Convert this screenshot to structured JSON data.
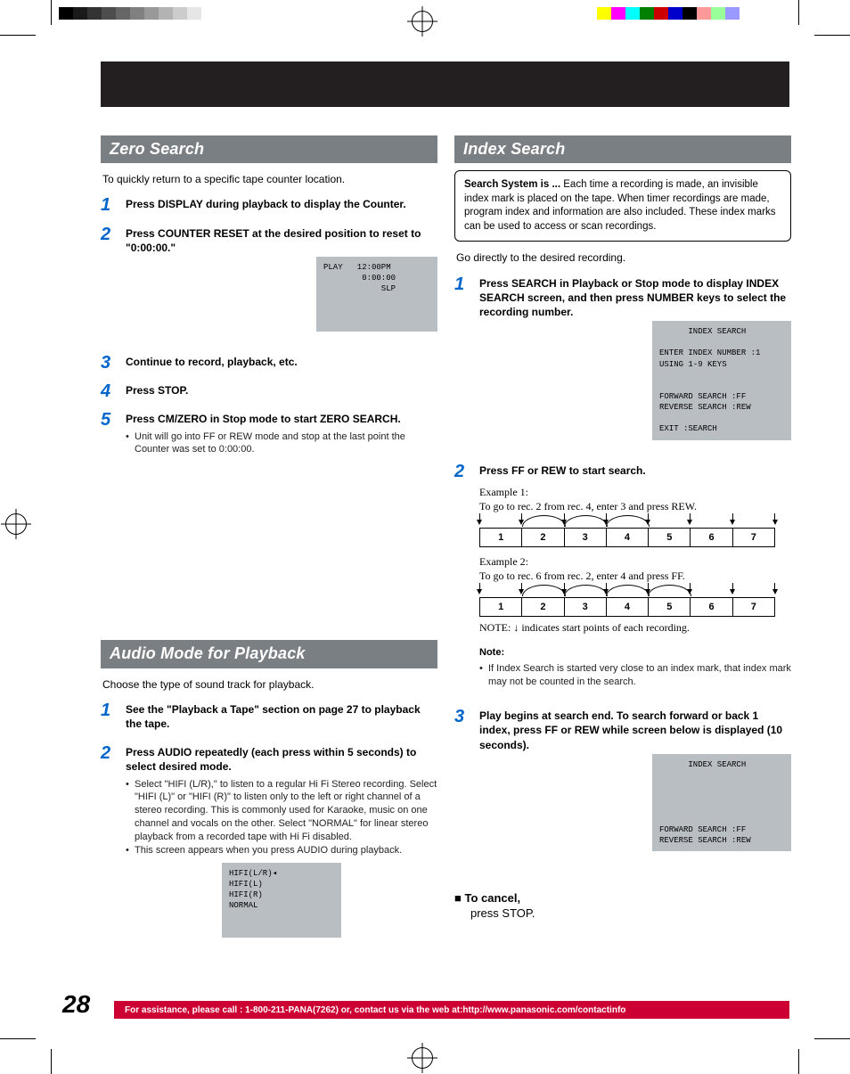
{
  "sections": {
    "zero": {
      "title": "Zero Search",
      "intro": "To quickly return to a specific tape counter location.",
      "steps": {
        "s1": "Press DISPLAY during playback to display the Counter.",
        "s2": "Press COUNTER RESET at the desired position to reset to \"0:00:00.\"",
        "s3": "Continue to record, playback, etc.",
        "s4": "Press STOP.",
        "s5": "Press CM/ZERO in Stop mode to start ZERO SEARCH.",
        "s5_notes": {
          "n1": "Unit will go into FF or REW mode and stop at the last point the Counter was set to 0:00:00."
        }
      },
      "osd": "PLAY   12:00PM\n        0:00:00\n            SLP"
    },
    "audio": {
      "title": "Audio Mode for Playback",
      "intro": "Choose the type of sound track for playback.",
      "steps": {
        "s1": "See the \"Playback a Tape\" section on page 27 to playback the tape.",
        "s2": "Press AUDIO repeatedly (each press within 5 seconds) to select desired mode.",
        "s2_notes": {
          "n1": "Select \"HIFI (L/R),\" to listen to a regular Hi Fi Stereo recording. Select \"HIFI (L)\" or \"HIFI (R)\" to listen only to the left or right channel of a stereo recording. This is commonly used for Karaoke, music on one channel and vocals on the other. Select \"NORMAL\" for linear stereo playback from a recorded tape with Hi Fi disabled.",
          "n2": "This screen appears when you press AUDIO during playback."
        }
      },
      "osd": "HIFI(L/R)◂\nHIFI(L)\nHIFI(R)\nNORMAL"
    },
    "index": {
      "title": "Index Search",
      "box": {
        "title": "Search System is ...",
        "body": "Each time a recording is made, an invisible index mark is placed on the tape. When timer recordings are made, program index and information are also included. These index marks can be used to access or scan recordings."
      },
      "intro": "Go directly to the desired recording.",
      "steps": {
        "s1": "Press SEARCH in Playback or Stop mode to display INDEX SEARCH screen, and then press NUMBER keys to select the recording number.",
        "s2": "Press FF or REW to start search.",
        "s3": "Play begins at search end. To search forward or back 1 index, press FF or REW while screen below is displayed (10 seconds)."
      },
      "osd1": "      INDEX SEARCH\n\nENTER INDEX NUMBER :1\nUSING 1-9 KEYS\n\n\nFORWARD SEARCH :FF\nREVERSE SEARCH :REW\n\nEXIT :SEARCH",
      "osd2": "      INDEX SEARCH\n\n\n\n\n\nFORWARD SEARCH :FF\nREVERSE SEARCH :REW",
      "ex1": {
        "label": "Example 1:",
        "desc": "To go to rec. 2 from rec. 4, enter 3 and press REW."
      },
      "ex2": {
        "label": "Example 2:",
        "desc": "To go to rec. 6 from rec. 2, enter 4 and press FF."
      },
      "diag_note": "NOTE: ↓ indicates start points of each recording.",
      "cells": {
        "c1": "1",
        "c2": "2",
        "c3": "3",
        "c4": "4",
        "c5": "5",
        "c6": "6",
        "c7": "7"
      },
      "note": {
        "title": "Note:",
        "n1": "If Index Search is started very close to an index mark, that index mark may not be counted in the search."
      },
      "cancel": {
        "title": "To cancel,",
        "body": "press STOP."
      }
    }
  },
  "footer": {
    "page": "28",
    "text": "For assistance, please call : 1-800-211-PANA(7262) or, contact us via the web at:http://www.panasonic.com/contactinfo"
  }
}
